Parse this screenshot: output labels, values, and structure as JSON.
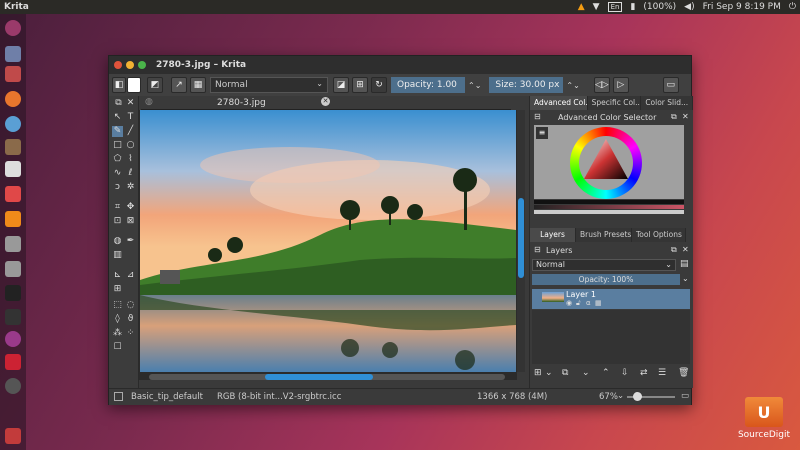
{
  "topbar": {
    "app_name": "Krita",
    "battery": "(100%)",
    "datetime": "Fri Sep  9  8:19 PM"
  },
  "window": {
    "title": "2780-3.jpg – Krita"
  },
  "toolbar": {
    "blend_mode": "Normal",
    "opacity_label": "Opacity: 1.00",
    "size_label": "Size: 30.00 px"
  },
  "document_tab": {
    "label": "2780-3.jpg"
  },
  "dock": {
    "top_tabs": [
      "Advanced Col...",
      "Specific Col...",
      "Color Slid..."
    ],
    "color_selector_title": "Advanced Color Selector",
    "mid_tabs": [
      "Layers",
      "Brush Presets",
      "Tool Options"
    ],
    "layers_title": "Layers",
    "blend_mode": "Normal",
    "opacity_label": "Opacity:  100%",
    "layer_name": "Layer 1"
  },
  "status": {
    "brush": "Basic_tip_default",
    "color_model": "RGB (8-bit int...V2-srgbtrc.icc",
    "dimensions": "1366 x 768 (4M)",
    "zoom": "67%"
  },
  "desktop": {
    "folder_label": "SourceDigit"
  },
  "colors": {
    "accent": "#5a7ea0",
    "slider": "#4d6f8c",
    "panel": "#3a3a3a"
  }
}
